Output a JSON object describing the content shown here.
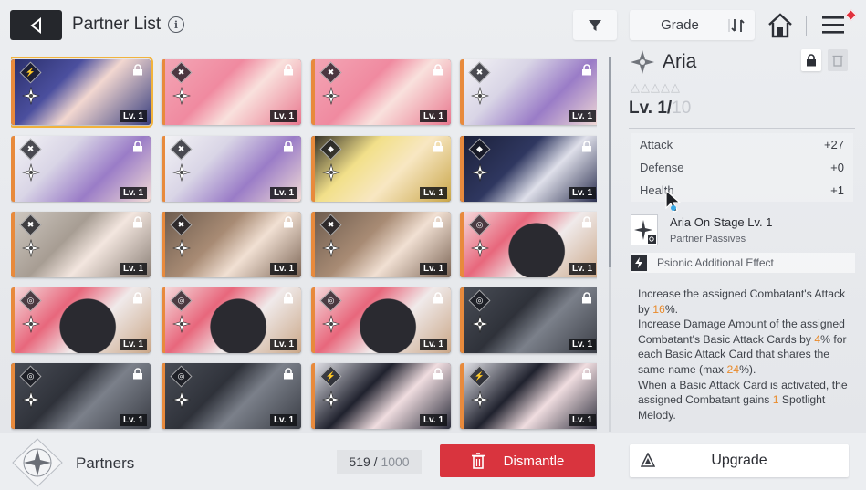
{
  "header": {
    "title": "Partner List",
    "info_icon": "i",
    "sort_label": "Grade"
  },
  "cards": [
    {
      "class": "psionic",
      "art": "navy-hair-girl",
      "level": "Lv. 1",
      "selected": true
    },
    {
      "class": "striker",
      "art": "pink-hair-girl",
      "level": "Lv. 1"
    },
    {
      "class": "striker",
      "art": "pink-hair-girl",
      "level": "Lv. 1"
    },
    {
      "class": "striker",
      "art": "witch-hat-girl",
      "level": "Lv. 1"
    },
    {
      "class": "striker",
      "art": "witch-hat-girl",
      "level": "Lv. 1"
    },
    {
      "class": "striker",
      "art": "witch-hat-girl",
      "level": "Lv. 1"
    },
    {
      "class": "vanguard",
      "art": "blonde-headset-girl",
      "level": "Lv. 1"
    },
    {
      "class": "vanguard",
      "art": "dark-hair-girl",
      "level": "Lv. 1"
    },
    {
      "class": "striker",
      "art": "ash-hair-girl",
      "level": "Lv. 1"
    },
    {
      "class": "striker",
      "art": "brown-hair-girl",
      "level": "Lv. 1"
    },
    {
      "class": "striker",
      "art": "brown-hair-girl",
      "level": "Lv. 1"
    },
    {
      "class": "controller",
      "art": "dark-mascot",
      "level": "Lv. 1"
    },
    {
      "class": "controller",
      "art": "dark-mascot",
      "level": "Lv. 1"
    },
    {
      "class": "controller",
      "art": "dark-mascot",
      "level": "Lv. 1"
    },
    {
      "class": "controller",
      "art": "dark-mascot",
      "level": "Lv. 1"
    },
    {
      "class": "controller",
      "art": "machine-claw",
      "level": "Lv. 1"
    },
    {
      "class": "controller",
      "art": "machine-claw",
      "level": "Lv. 1"
    },
    {
      "class": "controller",
      "art": "machine-claw",
      "level": "Lv. 1"
    },
    {
      "class": "psionic",
      "art": "glasses-girl",
      "level": "Lv. 1"
    },
    {
      "class": "psionic",
      "art": "glasses-girl",
      "level": "Lv. 1"
    }
  ],
  "detail": {
    "name": "Aria",
    "stars": "△△△△△",
    "level_current": "Lv. 1/",
    "level_max": "10",
    "stats": [
      {
        "label": "Attack",
        "value": "+27"
      },
      {
        "label": "Defense",
        "value": "+0"
      },
      {
        "label": "Health",
        "value": "+1"
      }
    ],
    "passive_title": "Aria On Stage Lv. 1",
    "passive_sub": "Partner Passives",
    "psionic_label": "Psionic Additional Effect",
    "desc": {
      "p1a": "Increase the assigned Combatant's Attack by ",
      "p1v": "16",
      "p1b": "%.",
      "p2a": "Increase Damage Amount of the assigned Combatant's Basic Attack Cards by ",
      "p2v": "4",
      "p2b": "% for each Basic Attack Card that shares the same name (max ",
      "p2v2": "24",
      "p2c": "%).",
      "p3a": "When a Basic Attack Card is activated, the assigned Combatant gains ",
      "p3v": "1",
      "p3b": " Spotlight Melody."
    }
  },
  "bottom": {
    "section_label": "Partners",
    "count_current": "519",
    "count_total": "1000",
    "dismantle_label": "Dismantle",
    "upgrade_label": "Upgrade"
  },
  "colors": {
    "accent_red": "#d9343e",
    "highlight_orange": "#e98a2a",
    "selected_outline": "#f2b33c"
  }
}
